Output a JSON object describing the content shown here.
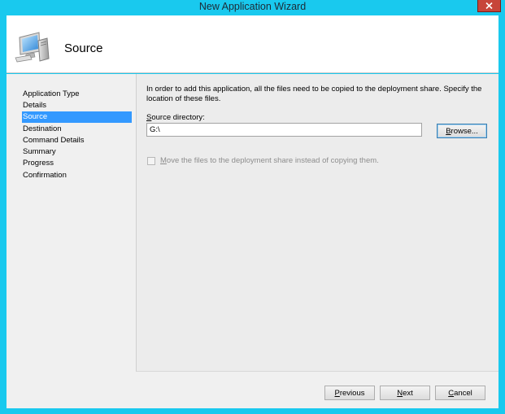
{
  "window": {
    "title": "New Application Wizard"
  },
  "header": {
    "title": "Source",
    "icon": "computer-icon"
  },
  "nav": {
    "items": [
      {
        "label": "Application Type",
        "selected": false
      },
      {
        "label": "Details",
        "selected": false
      },
      {
        "label": "Source",
        "selected": true
      },
      {
        "label": "Destination",
        "selected": false
      },
      {
        "label": "Command Details",
        "selected": false
      },
      {
        "label": "Summary",
        "selected": false
      },
      {
        "label": "Progress",
        "selected": false
      },
      {
        "label": "Confirmation",
        "selected": false
      }
    ]
  },
  "panel": {
    "instructions": "In order to add this application, all the files need to be copied to the deployment share.  Specify the location of these files.",
    "source_label_accel": "S",
    "source_label_rest": "ource directory:",
    "source_value": "G:\\",
    "browse_accel": "B",
    "browse_rest": "rowse...",
    "move_checkbox_accel": "M",
    "move_checkbox_rest": "ove the files to the deployment share instead of copying them.",
    "move_checkbox_checked": false,
    "move_checkbox_enabled": false
  },
  "footer": {
    "previous_accel": "P",
    "previous_rest": "revious",
    "next_accel": "N",
    "next_rest": "ext",
    "cancel_accel": "C",
    "cancel_rest": "ancel"
  },
  "colors": {
    "frame": "#19c9ee",
    "selection": "#3399ff",
    "close_button": "#c7453a"
  }
}
